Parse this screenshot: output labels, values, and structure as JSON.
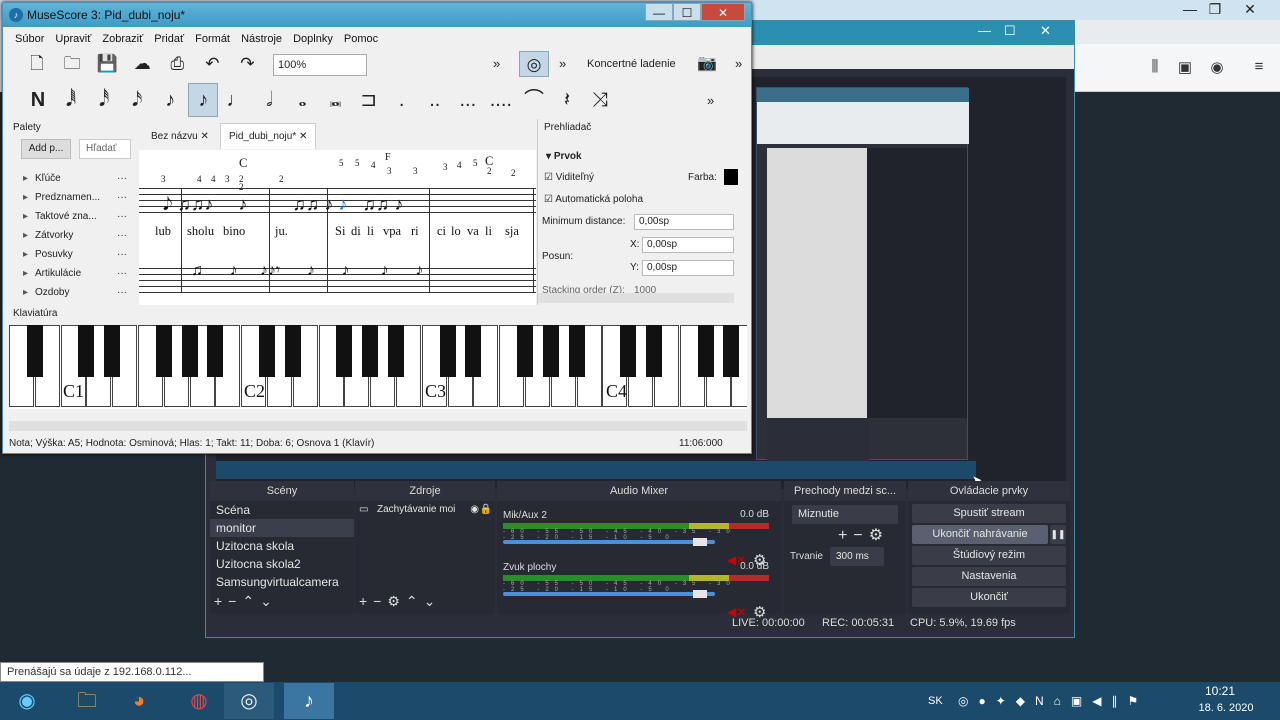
{
  "browser": {
    "toolbar_icons": [
      "library-icon",
      "reader-icon",
      "account-icon",
      "menu-icon"
    ],
    "window_buttons": [
      "—",
      "❐",
      "✕"
    ]
  },
  "obs": {
    "window_buttons": [
      "—",
      "☐",
      "✕"
    ],
    "docks": {
      "scenes_title": "Scény",
      "sources_title": "Zdroje",
      "mixer_title": "Audio Mixer",
      "transitions_title": "Prechody medzi sc...",
      "controls_title": "Ovládacie prvky"
    },
    "scenes": [
      "Scéna",
      "monitor",
      "Uzitocna skola",
      "Uzitocna skola2",
      "Samsungvirtualcamera"
    ],
    "selected_scene": "monitor",
    "sources": [
      "Zachytávanie moi"
    ],
    "mixer": [
      {
        "name": "Mik/Aux 2",
        "level": "0.0 dB",
        "volume": 0.96
      },
      {
        "name": "Zvuk plochy",
        "level": "0.0 dB",
        "volume": 0.96
      }
    ],
    "meter_scale": "-60 -55 -50 -45 -40 -35 -30 -25 -20 -15 -10 -5 0",
    "transition": {
      "type": "Miznutie",
      "duration_label": "Trvanie",
      "duration": "300 ms"
    },
    "controls": [
      "Spustiť stream",
      "Ukončiť nahrávanie",
      "Štúdiový režim",
      "Nastavenia",
      "Ukončiť"
    ],
    "pause_label": "❚❚",
    "status": {
      "live": "LIVE: 00:00:00",
      "rec": "REC: 00:05:31",
      "cpu": "CPU: 5.9%, 19.69 fps"
    }
  },
  "musescore": {
    "title": "MuseScore 3: Pid_dubi_noju*",
    "window_buttons": [
      "—",
      "☐",
      "✕"
    ],
    "menu": [
      "Súbor",
      "Upraviť",
      "Zobraziť",
      "Pridať",
      "Formát",
      "Nástroje",
      "Doplnky",
      "Pomoc"
    ],
    "zoom": "100%",
    "concert_pitch": "Koncertné ladenie",
    "toolbar_more": "»",
    "palettes": {
      "title": "Palety",
      "add_button": "Add p...",
      "search_placeholder": "Hľadať",
      "items": [
        "Kľúče",
        "Predznamen...",
        "Taktové zna...",
        "Zátvorky",
        "Posuvky",
        "Artikulácie",
        "Ozdoby"
      ],
      "item_more": "···"
    },
    "tabs": [
      "Bez názvu",
      "Pid_dubi_noju*"
    ],
    "tab_close": "✕",
    "score": {
      "chords": [
        "C",
        "F",
        "C"
      ],
      "fingerings": [
        "3",
        "4",
        "4",
        "3",
        "2",
        "2",
        "2",
        "5",
        "5",
        "4",
        "3",
        "3",
        "3",
        "4",
        "5",
        "2",
        "2"
      ],
      "lyrics": [
        "lub",
        "sholu",
        "bino",
        "ju.",
        "Si",
        "di",
        "li",
        "vpa",
        "ri",
        "ci",
        "lo",
        "va",
        "li",
        "sja"
      ]
    },
    "inspector": {
      "title": "Prehliadač",
      "section": "Prvok",
      "visible_label": "Viditeľný",
      "color_label": "Farba:",
      "auto_position_label": "Automatická poloha",
      "min_distance_label": "Minimum distance:",
      "min_distance": "0,00sp",
      "offset_label": "Posun:",
      "x_label": "X:",
      "x_value": "0,00sp",
      "y_label": "Y:",
      "y_value": "0,00sp",
      "stacking_label": "Stacking order (Z):",
      "stacking_value": "1000"
    },
    "keyboard": {
      "title": "Klaviatúra",
      "labels": [
        "C1",
        "C2",
        "C3",
        "C4"
      ]
    },
    "status_left": "Nota; Výška: A5; Hodnota: Osminová; Hlas: 1;  Takt: 11; Doba: 6; Osnova 1 (Klavír)",
    "status_right": "11:06:000"
  },
  "tooltip": "Prenášajú sa údaje z 192.168.0.112...",
  "taskbar": {
    "language": "SK",
    "time": "10:21",
    "date": "18. 6. 2020",
    "start_icon": "start-orb-icon",
    "apps": [
      "folder-icon",
      "firefox-icon",
      "chrome-icon",
      "obs-icon",
      "musescore-icon"
    ]
  },
  "colors": {
    "obs_accent": "#2b8fb0",
    "ms_title": "#4aa6cf",
    "taskbar": "#1c4a6a"
  }
}
